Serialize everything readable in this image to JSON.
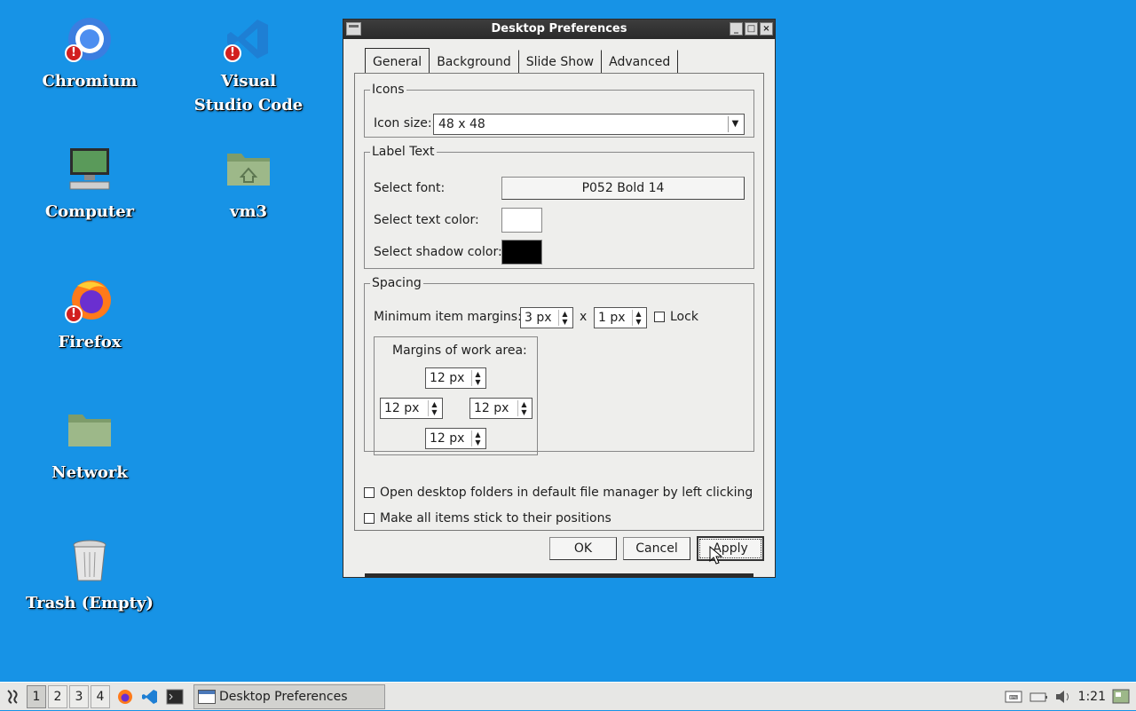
{
  "desktop": {
    "icons": [
      {
        "label": "Chromium"
      },
      {
        "label": "Visual Studio Code"
      },
      {
        "label": "Computer"
      },
      {
        "label": "vm3"
      },
      {
        "label": "Firefox"
      },
      {
        "label": "Network"
      },
      {
        "label": "Trash (Empty)"
      }
    ],
    "badge": "!"
  },
  "dialog": {
    "title": "Desktop Preferences",
    "tabs": [
      "General",
      "Background",
      "Slide Show",
      "Advanced"
    ],
    "active_tab": "General",
    "icons_group": {
      "legend": "Icons",
      "icon_size_label": "Icon size:",
      "icon_size_value": "48 x 48"
    },
    "label_group": {
      "legend": "Label Text",
      "font_label": "Select font:",
      "font_value": "P052 Bold 14",
      "text_color_label": "Select text color:",
      "text_color": "#ffffff",
      "shadow_color_label": "Select shadow color:",
      "shadow_color": "#000000"
    },
    "spacing_group": {
      "legend": "Spacing",
      "min_margins_label": "Minimum item margins:",
      "margin_x": "3 px",
      "times": "x",
      "margin_y": "1 px",
      "lock_label": "Lock",
      "lock_checked": false,
      "work_area_label": "Margins of work area:",
      "work_top": "12 px",
      "work_left": "12 px",
      "work_right": "12 px",
      "work_bottom": "12 px"
    },
    "open_folders_label": "Open desktop folders in default file manager by left clicking",
    "open_folders_checked": false,
    "stick_label": "Make all items stick to their positions",
    "stick_checked": false,
    "buttons": {
      "ok": "OK",
      "cancel": "Cancel",
      "apply": "Apply"
    }
  },
  "taskbar": {
    "workspaces": [
      "1",
      "2",
      "3",
      "4"
    ],
    "active_workspace": "1",
    "window_button": "Desktop Preferences",
    "clock": "1:21"
  },
  "colors": {
    "desktop_bg": "#1793e6",
    "dialog_bg": "#eeeeec",
    "titlebar": "#2a2a2a"
  }
}
